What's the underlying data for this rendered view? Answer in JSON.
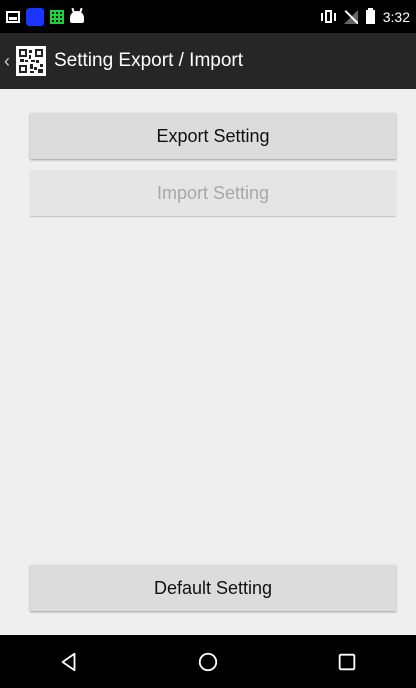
{
  "status_bar": {
    "time": "3:32",
    "icons": [
      "gallery-icon",
      "blue-app-icon",
      "green-app-icon",
      "android-icon",
      "vibrate-icon",
      "no-signal-icon",
      "battery-icon"
    ]
  },
  "action_bar": {
    "title": "Setting Export / Import",
    "back_glyph": "‹"
  },
  "main": {
    "export_label": "Export Setting",
    "import_label": "Import Setting",
    "import_enabled": false,
    "default_label": "Default Setting"
  },
  "nav_bar": {
    "buttons": [
      "back-icon",
      "home-icon",
      "recents-icon"
    ]
  }
}
